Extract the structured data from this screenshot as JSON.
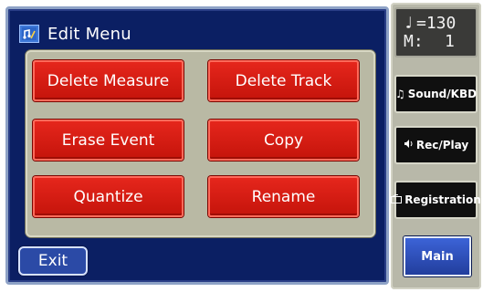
{
  "screen": {
    "title": "Edit Menu",
    "title_icon": "note-edit-icon",
    "buttons": [
      {
        "label": "Delete Measure"
      },
      {
        "label": "Delete Track"
      },
      {
        "label": "Erase Event"
      },
      {
        "label": "Copy"
      },
      {
        "label": "Quantize"
      },
      {
        "label": "Rename"
      }
    ],
    "exit_label": "Exit"
  },
  "side_panel": {
    "tempo": {
      "note_symbol": "♩",
      "tempo_value": "=130",
      "measure_label": "M:",
      "measure_value": "1"
    },
    "buttons": [
      {
        "label": "Sound/KBD",
        "icon": "music-note-icon"
      },
      {
        "label": "Rec/Play",
        "icon": "speaker-icon"
      },
      {
        "label": "Registration",
        "icon": "registration-icon"
      }
    ],
    "main_label": "Main"
  },
  "colors": {
    "screen_bg": "#0b1f63",
    "button_red": "#d71c12",
    "button_area": "#b9b9a4",
    "main_blue": "#2f4fb8"
  }
}
